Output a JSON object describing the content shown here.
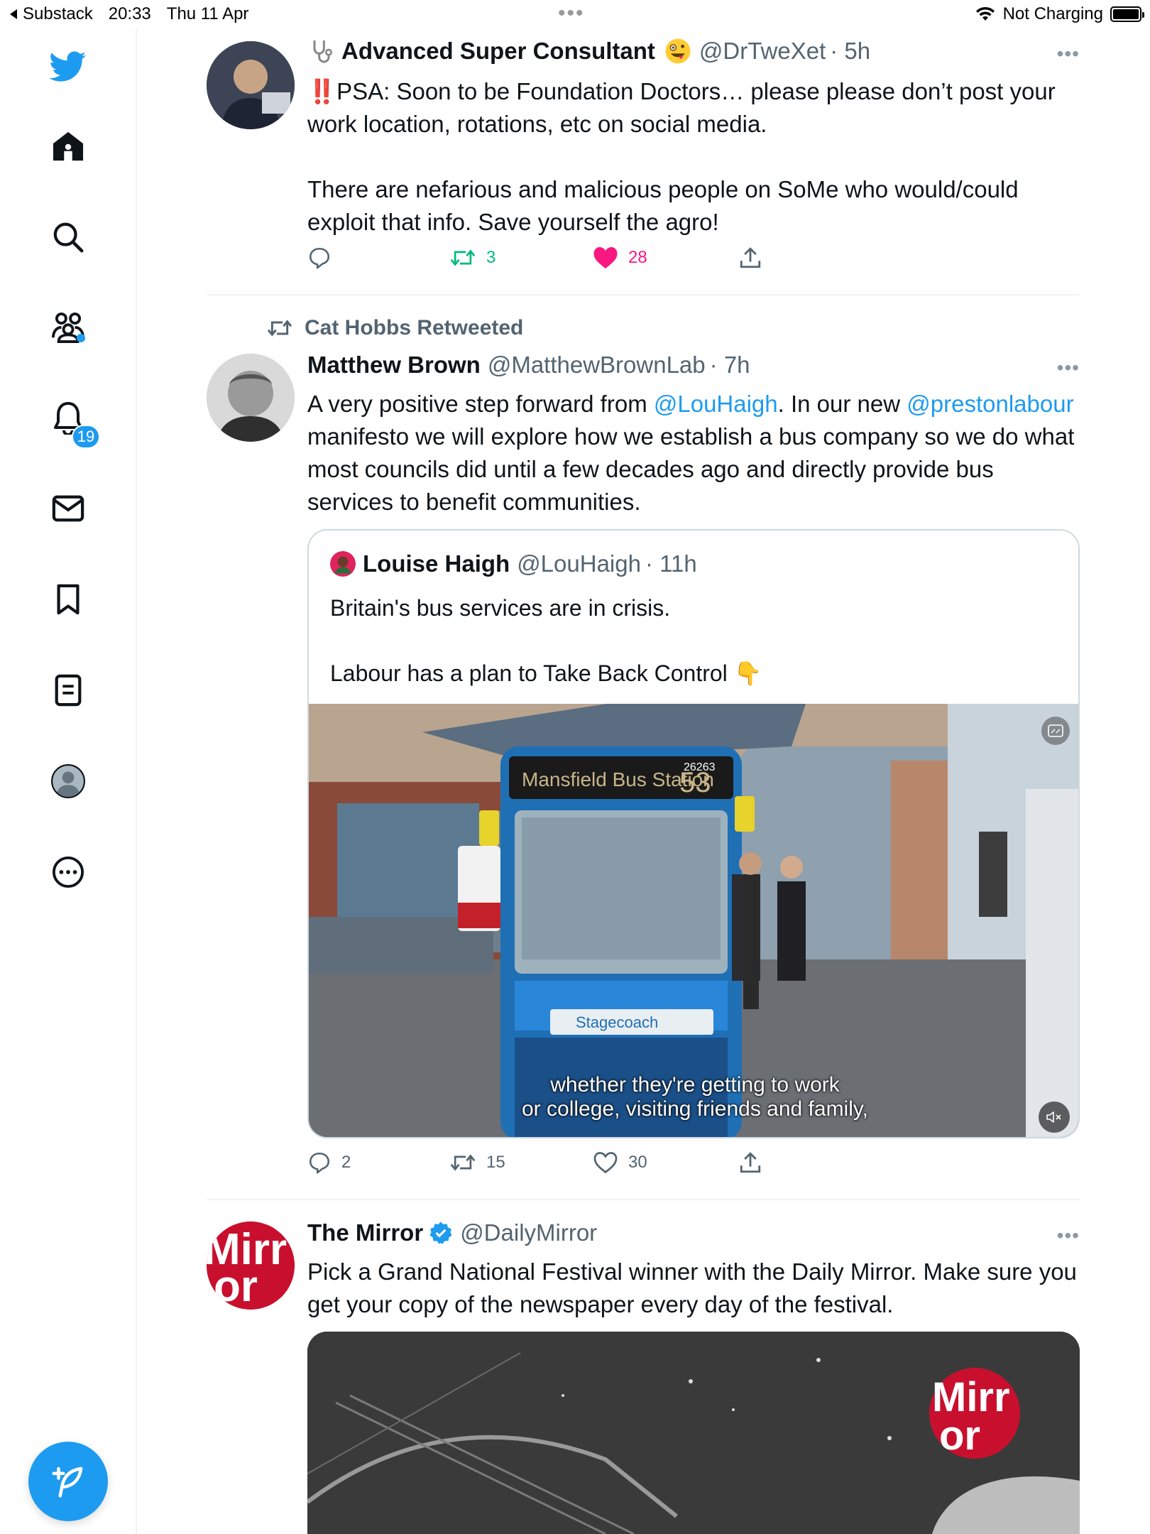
{
  "status_bar": {
    "back_app": "Substack",
    "time": "20:33",
    "date": "Thu 11 Apr",
    "dots": "•••",
    "charging": "Not Charging"
  },
  "sidebar": {
    "items": [
      "twitter-logo",
      "home",
      "explore",
      "communities",
      "notifications",
      "messages",
      "bookmarks",
      "lists",
      "profile",
      "more"
    ],
    "notifications_badge": "19"
  },
  "tweets": [
    {
      "name": "Advanced Super Consultant",
      "handle": "@DrTweXet",
      "time": "· 5h",
      "text_line1": "‼️PSA: Soon to be Foundation Doctors… please please don’t post your work location, rotations, etc on social media.",
      "text_line2": "There are nefarious and malicious people on SoMe who would/could exploit that info. Save yourself the agro!",
      "retweets": "3",
      "likes": "28"
    },
    {
      "retweeted_by": "Cat Hobbs Retweeted",
      "name": "Matthew Brown",
      "handle": "@MatthewBrownLab",
      "time": "· 7h",
      "text_a": "A very positive step forward from ",
      "link1": "@LouHaigh",
      "text_b": ". In our new ",
      "link2": "@prestonlabour",
      "text_c": " manifesto we will explore how we establish a bus company so we do what most councils did until a few decades ago and directly provide bus services to benefit communities.",
      "replies": "2",
      "retweets": "15",
      "likes": "30",
      "quote": {
        "name": "Louise Haigh",
        "handle": "@LouHaigh",
        "time": "· 11h",
        "text": "Britain's bus services are in crisis.\n\nLabour has a plan to Take Back Control 👇",
        "video_caption_line1": "whether they're getting to work",
        "video_caption_line2": "or college, visiting friends and family,",
        "bus_destination": "Mansfield Bus Station",
        "bus_route": "53",
        "bus_fleet_number": "26263",
        "bus_brand": "Stagecoach"
      }
    },
    {
      "name": "The Mirror",
      "handle": "@DailyMirror",
      "text": "Pick a Grand National Festival winner with the Daily Mirror. Make sure you get your copy of the newspaper every day of the festival.",
      "logo_text": "Mirror"
    }
  ],
  "colors": {
    "accent": "#1d9bf0",
    "like": "#f91880",
    "retweet_active": "#00ba7c",
    "secondary_text": "#536471",
    "mirror_red": "#c8102e"
  }
}
